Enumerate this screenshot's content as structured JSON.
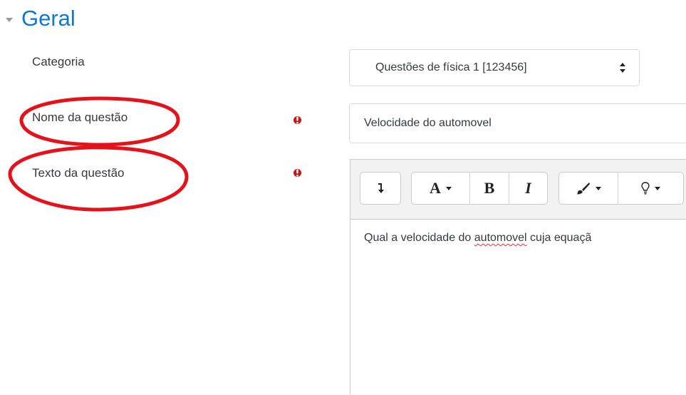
{
  "section": {
    "title": "Geral"
  },
  "fields": {
    "categoria": {
      "label": "Categoria",
      "value": "Questões de física 1 [123456]"
    },
    "nome": {
      "label": "Nome da questão",
      "value": "Velocidade do automovel",
      "required": true
    },
    "texto": {
      "label": "Texto da questão",
      "required": true,
      "content_prefix": "Qual a velocidade do ",
      "content_misspelled": "automovel",
      "content_suffix": " cuja equaçã"
    }
  },
  "toolbar": {
    "groups": [
      [
        "collapse-icon"
      ],
      [
        "font-color-dropdown",
        "bold",
        "italic"
      ],
      [
        "brush-dropdown",
        "lightbulb-dropdown"
      ]
    ],
    "font_label": "A",
    "bold_label": "B",
    "italic_label": "I",
    "collapse_glyph": "↴"
  },
  "colors": {
    "accent": "#1177d1",
    "required": "#c41717",
    "annotation": "#e3131b"
  },
  "annotations": [
    {
      "shape": "ellipse",
      "color": "#e3131b",
      "target": "Nome da questão"
    },
    {
      "shape": "ellipse",
      "color": "#e3131b",
      "target": "Texto da questão"
    }
  ]
}
